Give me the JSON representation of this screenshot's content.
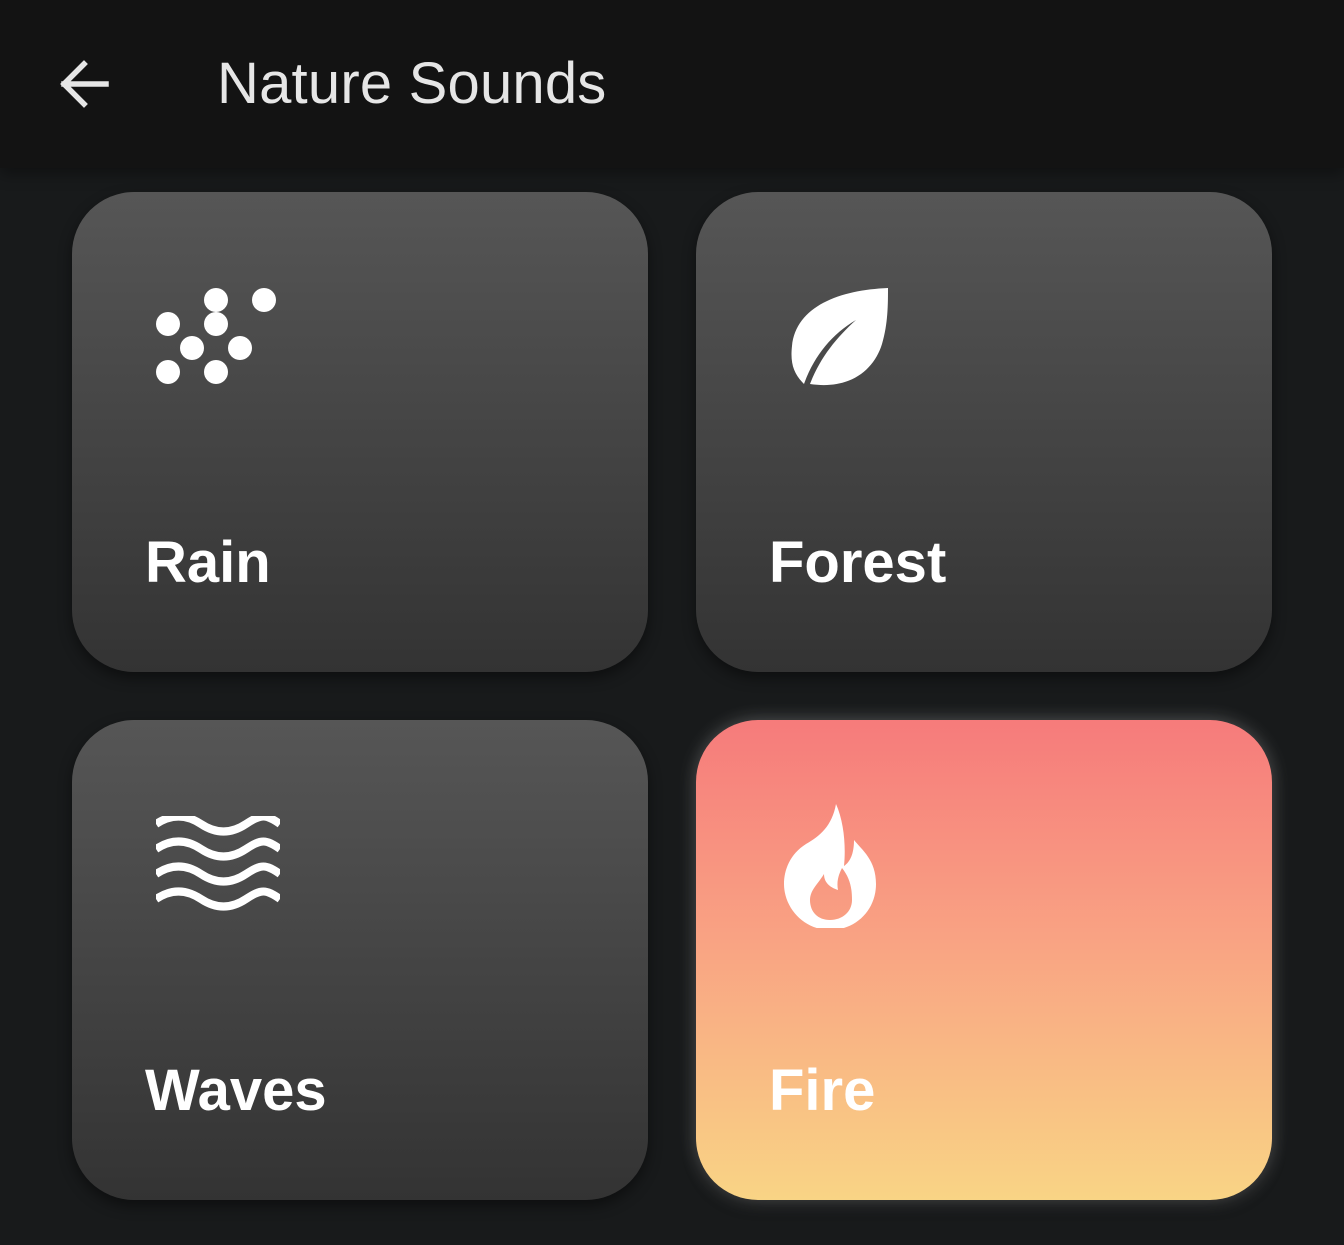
{
  "header": {
    "title": "Nature Sounds",
    "back_icon": "arrow-left-icon"
  },
  "colors": {
    "background": "#181a1b",
    "app_bar": "#131313",
    "card_top": "#565656",
    "card_bottom": "#333333",
    "active_top": "#f67b7b",
    "active_bottom": "#f9d485",
    "text": "#ffffff"
  },
  "sounds": [
    {
      "label": "Rain",
      "icon": "rain-drops-icon",
      "active": false
    },
    {
      "label": "Forest",
      "icon": "leaf-icon",
      "active": false
    },
    {
      "label": "Waves",
      "icon": "waves-icon",
      "active": false
    },
    {
      "label": "Fire",
      "icon": "flame-icon",
      "active": true
    }
  ]
}
